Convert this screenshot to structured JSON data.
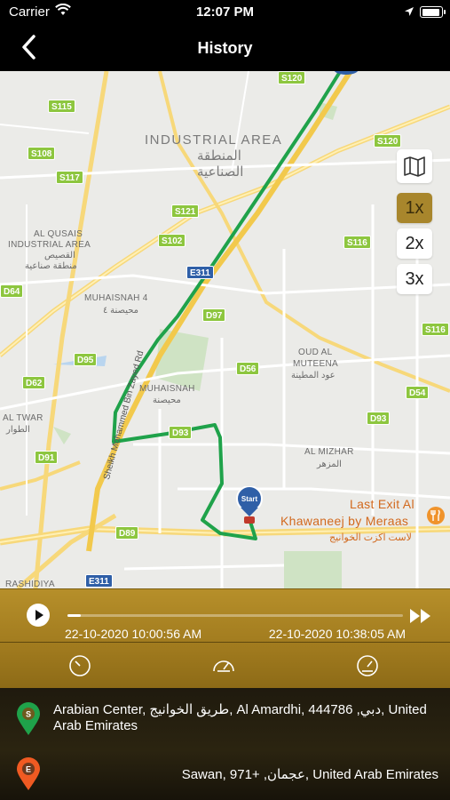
{
  "status_bar": {
    "carrier": "Carrier",
    "time": "12:07 PM"
  },
  "nav": {
    "title": "History"
  },
  "map": {
    "areas": [
      {
        "text": "INDUSTRIAL AREA"
      },
      {
        "text": "المنطقة"
      },
      {
        "text": "الصناعية"
      },
      {
        "text": "AL QUSAIS"
      },
      {
        "text": "INDUSTRIAL AREA"
      },
      {
        "text": "القصيص"
      },
      {
        "text": "منطقة صناعية"
      },
      {
        "text": "MUHAISNAH 4"
      },
      {
        "text": "محيصنة ٤"
      },
      {
        "text": "MUHAISNAH"
      },
      {
        "text": "محيصنة"
      },
      {
        "text": "OUD AL"
      },
      {
        "text": "MUTEENA"
      },
      {
        "text": "عود المطينة"
      },
      {
        "text": "AL MIZHAR"
      },
      {
        "text": "المزهر"
      },
      {
        "text": "AL TWAR"
      },
      {
        "text": "الطوار"
      },
      {
        "text": "RASHIDIYA"
      }
    ],
    "poi": {
      "name_line1": "Last Exit Al",
      "name_line2": "Khawaneej by Meraas",
      "name_ar": "لاست اكزت الخوانيج"
    },
    "road_name": "Sheikh Mohammed Bin Zayed Rd",
    "shields": [
      {
        "t": "S120"
      },
      {
        "t": "S115"
      },
      {
        "t": "S108"
      },
      {
        "t": "S117"
      },
      {
        "t": "S121"
      },
      {
        "t": "S102"
      },
      {
        "t": "S120"
      },
      {
        "t": "S116"
      },
      {
        "t": "D64"
      },
      {
        "t": "D97"
      },
      {
        "t": "D95"
      },
      {
        "t": "D62"
      },
      {
        "t": "D56"
      },
      {
        "t": "D54"
      },
      {
        "t": "D93"
      },
      {
        "t": "D91"
      },
      {
        "t": "D93"
      },
      {
        "t": "D89"
      },
      {
        "t": "S116"
      },
      {
        "t": "E311"
      },
      {
        "t": "E311"
      }
    ],
    "controls": {
      "layers_icon": "map-icon",
      "speed_1x": "1x",
      "speed_2x": "2x",
      "speed_3x": "3x",
      "active_speed": "1x"
    },
    "route_color": "#1fa24a",
    "marker_label": "Start"
  },
  "player": {
    "progress_fraction": 0.04,
    "start_time": "22-10-2020 10:00:56 AM",
    "end_time": "22-10-2020 10:38:05 AM",
    "accent": "#a8862c"
  },
  "addresses": {
    "start": {
      "badge": "S",
      "text": "Arabian Center, طريق الخوانيج, Al Amardhi, دبي, 444786, United Arab Emirates",
      "color": "#1fa24a"
    },
    "end": {
      "badge": "E",
      "text": "Sawan, 971+ ,عجمان, United Arab Emirates",
      "color": "#f05a22"
    }
  }
}
